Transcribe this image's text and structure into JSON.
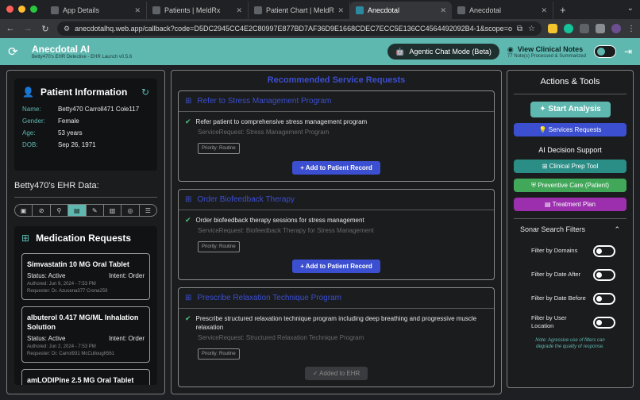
{
  "browser": {
    "tabs": [
      {
        "title": "App Details",
        "active": false
      },
      {
        "title": "Patients | MeldRx",
        "active": false
      },
      {
        "title": "Patient Chart | MeldRx",
        "active": false
      },
      {
        "title": "Anecdotal",
        "active": true
      },
      {
        "title": "Anecdotal",
        "active": false
      }
    ],
    "url": "anecdotalhq.web.app/callback?code=D5DC2945CC4E2C80997E877BD7AF36D9E1668CDEC7ECC5E136CC4564492092B4-1&scope=openid+profil..."
  },
  "header": {
    "title": "Anecdotal AI",
    "subtitle": "Betty470's EHR Detective - EHR Launch v0.5.6",
    "chat_mode_label": "Agentic Chat Mode (Beta)",
    "clinical_notes_label": "View Clinical Notes",
    "clinical_notes_sub": "77 Note(s) Processed & Summarized"
  },
  "patient": {
    "section_title": "Patient Information",
    "fields": [
      {
        "key": "Name:",
        "value": "Betty470 Carroll471 Cole117"
      },
      {
        "key": "Gender:",
        "value": "Female"
      },
      {
        "key": "Age:",
        "value": "53 years"
      },
      {
        "key": "DOB:",
        "value": "Sep 26, 1971"
      }
    ],
    "ehr_title": "Betty470's EHR Data:"
  },
  "medications": {
    "section_title": "Medication Requests",
    "items": [
      {
        "name": "Simvastatin 10 MG Oral Tablet",
        "status": "Status: Active",
        "intent": "Intent: Order",
        "authored": "Authored: Jun 9, 2024 - 7:53 PM",
        "requester": "Requester: Dr. Azucena377 Crona259"
      },
      {
        "name": "albuterol 0.417 MG/ML Inhalation Solution",
        "status": "Status: Active",
        "intent": "Intent: Order",
        "authored": "Authored: Jun 2, 2024 - 7:53 PM",
        "requester": "Requester: Dr. Carrol931 McCullough561"
      },
      {
        "name": "amLODIPine 2.5 MG Oral Tablet",
        "status": "",
        "intent": "",
        "authored": "",
        "requester": ""
      }
    ]
  },
  "service_requests": {
    "title": "Recommended Service Requests",
    "items": [
      {
        "title": "Refer to Stress Management Program",
        "description": "Refer patient to comprehensive stress management program",
        "service": "ServiceRequest: Stress Management Program",
        "priority": "Priority: Routine",
        "action": "Add to Patient Record"
      },
      {
        "title": "Order Biofeedback Therapy",
        "description": "Order biofeedback therapy sessions for stress management",
        "service": "ServiceRequest: Biofeedback Therapy for Stress Management",
        "priority": "Priority: Routine",
        "action": "Add to Patient Record"
      },
      {
        "title": "Prescribe Relaxation Technique Program",
        "description": "Prescribe structured relaxation technique program including deep breathing and progressive muscle relaxation",
        "service": "ServiceRequest: Structured Relaxation Technique Program",
        "priority": "Priority: Routine",
        "action": "Added to EHR"
      }
    ]
  },
  "actions": {
    "title": "Actions & Tools",
    "start_analysis": "Start Analysis",
    "services_requests": "Services Requests",
    "ai_support_title": "AI Decision Support",
    "clinical_prep": "Clinical Prep Tool",
    "preventive_care": "Preventive Care (Patient)",
    "treatment_plan": "Treatment Plan",
    "sonar_title": "Sonar Search Filters",
    "filters": [
      {
        "label": "Filter by Domains",
        "on": false
      },
      {
        "label": "Filter by Date After",
        "on": false
      },
      {
        "label": "Filter by Date Before",
        "on": false
      },
      {
        "label": "Filter by User Location",
        "on": false
      }
    ],
    "filter_note": "Note: Agressive use of filters can degrade the quality of response."
  },
  "icons": {
    "traffic_close": "#ff5f57",
    "traffic_min": "#febc2e",
    "traffic_max": "#28c840"
  }
}
